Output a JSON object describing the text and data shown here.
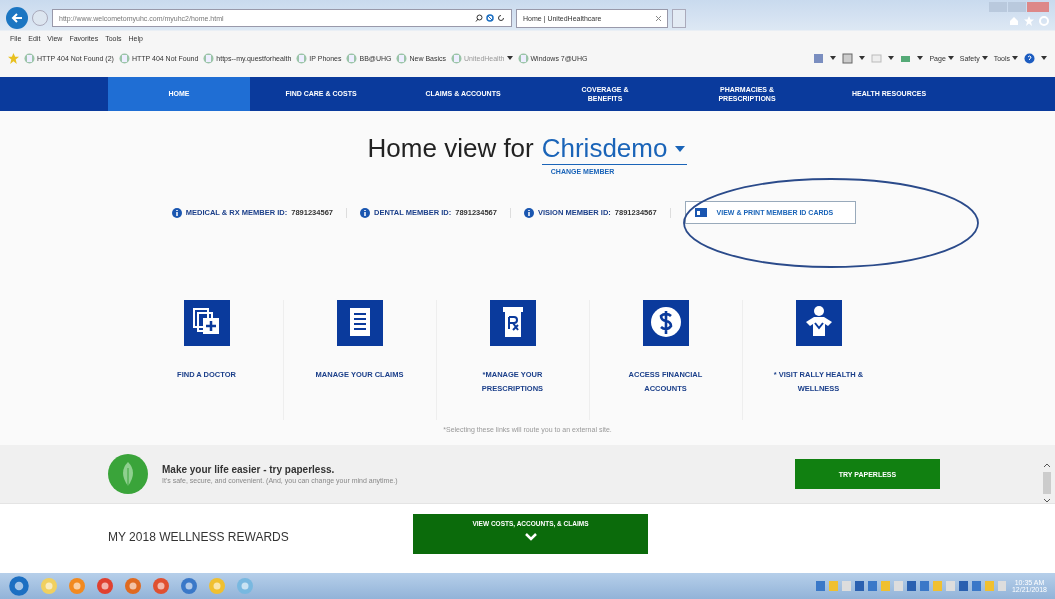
{
  "browser": {
    "address": "http://www.welcometomyuhc.com/myuhc2/home.html",
    "tab_title": "Home | UnitedHealthcare",
    "menu": [
      "File",
      "Edit",
      "View",
      "Favorites",
      "Tools",
      "Help"
    ],
    "favorites": [
      {
        "label": "HTTP 404 Not Found (2)",
        "dropdown": false
      },
      {
        "label": "HTTP 404 Not Found",
        "dropdown": false
      },
      {
        "label": "https--my.questforhealth",
        "dropdown": false
      },
      {
        "label": "IP Phones",
        "dropdown": false
      },
      {
        "label": "BB@UHG",
        "dropdown": false
      },
      {
        "label": "New Basics",
        "dropdown": false
      },
      {
        "label": "UnitedHealth",
        "dropdown": true
      },
      {
        "label": "Windows 7@UHG",
        "dropdown": false
      }
    ],
    "commands": [
      "Page",
      "Safety",
      "Tools"
    ]
  },
  "nav": [
    {
      "label": "HOME",
      "selected": true
    },
    {
      "label": "FIND CARE & COSTS",
      "selected": false
    },
    {
      "label": "CLAIMS & ACCOUNTS",
      "selected": false
    },
    {
      "label": "COVERAGE & BENEFITS",
      "selected": false
    },
    {
      "label": "PHARMACIES & PRESCRIPTIONS",
      "selected": false
    },
    {
      "label": "HEALTH RESOURCES",
      "selected": false
    }
  ],
  "header": {
    "title": "Home view for",
    "member": "Chrisdemo",
    "change_member": "CHANGE MEMBER"
  },
  "member_ids": [
    {
      "label": "MEDICAL & RX MEMBER ID:",
      "value": "7891234567"
    },
    {
      "label": "DENTAL MEMBER ID:",
      "value": "7891234567"
    },
    {
      "label": "VISION MEMBER ID:",
      "value": "7891234567"
    }
  ],
  "id_cards_button": "VIEW & PRINT MEMBER ID CARDS",
  "tiles": [
    {
      "kind": "doctor",
      "label": "FIND A DOCTOR"
    },
    {
      "kind": "claims",
      "label": "MANAGE YOUR CLAIMS"
    },
    {
      "kind": "rx",
      "label": "*MANAGE YOUR PRESCRIPTIONS"
    },
    {
      "kind": "dollar",
      "label": "ACCESS FINANCIAL ACCOUNTS"
    },
    {
      "kind": "person",
      "label": "* VISIT RALLY HEALTH & WELLNESS"
    }
  ],
  "footnote": "*Selecting these links will route you to an external site.",
  "paperless": {
    "title": "Make your life easier - try paperless.",
    "text": "It's safe, secure, and convenient. (And, you can change your mind anytime.)",
    "button": "TRY PAPERLESS"
  },
  "wellness": {
    "heading": "MY 2018 WELLNESS REWARDS",
    "button": "VIEW COSTS, ACCOUNTS, & CLAIMS"
  },
  "taskbar": {
    "time": "10:35 AM",
    "date": "12/21/2018"
  }
}
